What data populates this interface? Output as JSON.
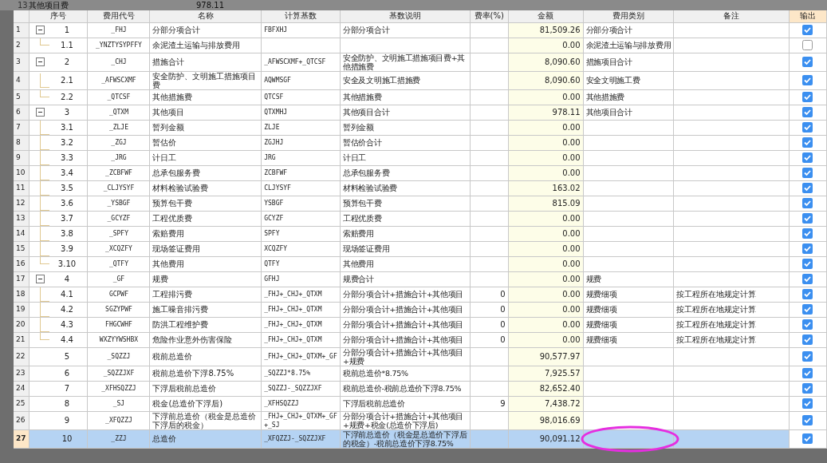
{
  "background_row": {
    "num": "13",
    "name": "其他项目费",
    "amount": "978.11"
  },
  "table": {
    "columns": [
      "序号",
      "费用代号",
      "名称",
      "计算基数",
      "基数说明",
      "费率(%)",
      "金额",
      "费用类别",
      "备注",
      "输出"
    ],
    "rows": [
      {
        "num": "1",
        "seq": "1",
        "code": "_FHJ",
        "name": "分部分项合计",
        "base": "FBFXHJ",
        "base_desc": "分部分项合计",
        "amount": "81,509.26",
        "category": "分部分项合计",
        "output": true,
        "selected": false,
        "expanded": true,
        "children": [
          {
            "num": "2",
            "seq": "1.1",
            "code": "_YNZTYSYPFFY",
            "name": "余泥渣土运输与排放费用",
            "amount": "0.00",
            "category": "余泥渣土运输与排放费用",
            "output": false,
            "selected": false
          }
        ]
      },
      {
        "num": "3",
        "seq": "2",
        "code": "_CHJ",
        "name": "措施合计",
        "base": "_AFWSCXMF+_QTCSF",
        "base_desc": "安全防护、文明施工措施项目费+其他措施费",
        "amount": "8,090.60",
        "category": "措施项目合计",
        "output": true,
        "selected": false,
        "expanded": true,
        "children": [
          {
            "num": "4",
            "seq": "2.1",
            "code": "_AFWSCXMF",
            "name": "安全防护、文明施工措施项目费",
            "base": "AQWMSGF",
            "base_desc": "安全及文明施工措施费",
            "amount": "8,090.60",
            "category": "安全文明施工费",
            "output": true,
            "selected": false
          },
          {
            "num": "5",
            "seq": "2.2",
            "code": "_QTCSF",
            "name": "其他措施费",
            "base": "QTCSF",
            "base_desc": "其他措施费",
            "amount": "0.00",
            "category": "其他措施费",
            "output": true,
            "selected": false
          }
        ]
      },
      {
        "num": "6",
        "seq": "3",
        "code": "_QTXM",
        "name": "其他项目",
        "base": "QTXMHJ",
        "base_desc": "其他项目合计",
        "amount": "978.11",
        "category": "其他项目合计",
        "output": true,
        "selected": false,
        "expanded": true,
        "children": [
          {
            "num": "7",
            "seq": "3.1",
            "code": "_ZLJE",
            "name": "暂列金额",
            "base": "ZLJE",
            "base_desc": "暂列金额",
            "amount": "0.00",
            "output": true,
            "selected": false
          },
          {
            "num": "8",
            "seq": "3.2",
            "code": "_ZGJ",
            "name": "暂估价",
            "base": "ZGJHJ",
            "base_desc": "暂估价合计",
            "amount": "0.00",
            "output": true,
            "selected": false
          },
          {
            "num": "9",
            "seq": "3.3",
            "code": "_JRG",
            "name": "计日工",
            "base": "JRG",
            "base_desc": "计日工",
            "amount": "0.00",
            "output": true,
            "selected": false
          },
          {
            "num": "10",
            "seq": "3.4",
            "code": "_ZCBFWF",
            "name": "总承包服务费",
            "base": "ZCBFWF",
            "base_desc": "总承包服务费",
            "amount": "0.00",
            "output": true,
            "selected": false
          },
          {
            "num": "11",
            "seq": "3.5",
            "code": "_CLJYSYF",
            "name": "材料检验试验费",
            "base": "CLJYSYF",
            "base_desc": "材料检验试验费",
            "amount": "163.02",
            "output": true,
            "selected": false
          },
          {
            "num": "12",
            "seq": "3.6",
            "code": "_YSBGF",
            "name": "预算包干费",
            "base": "YSBGF",
            "base_desc": "预算包干费",
            "amount": "815.09",
            "output": true,
            "selected": false
          },
          {
            "num": "13",
            "seq": "3.7",
            "code": "_GCYZF",
            "name": "工程优质费",
            "base": "GCYZF",
            "base_desc": "工程优质费",
            "amount": "0.00",
            "output": true,
            "selected": false
          },
          {
            "num": "14",
            "seq": "3.8",
            "code": "_SPFY",
            "name": "索赔费用",
            "base": "SPFY",
            "base_desc": "索赔费用",
            "amount": "0.00",
            "output": true,
            "selected": false
          },
          {
            "num": "15",
            "seq": "3.9",
            "code": "_XCQZFY",
            "name": "现场签证费用",
            "base": "XCQZFY",
            "base_desc": "现场签证费用",
            "amount": "0.00",
            "output": true,
            "selected": false
          },
          {
            "num": "16",
            "seq": "3.10",
            "code": "_QTFY",
            "name": "其他费用",
            "base": "QTFY",
            "base_desc": "其他费用",
            "amount": "0.00",
            "output": true,
            "selected": false
          }
        ]
      },
      {
        "num": "17",
        "seq": "4",
        "code": "_GF",
        "name": "规费",
        "base": "GFHJ",
        "base_desc": "规费合计",
        "amount": "0.00",
        "category": "规费",
        "output": true,
        "selected": false,
        "expanded": true,
        "children": [
          {
            "num": "18",
            "seq": "4.1",
            "code": "GCPWF",
            "name": "工程排污费",
            "base": "_FHJ+_CHJ+_QTXM",
            "base_desc": "分部分项合计+措施合计+其他项目",
            "rate": "0",
            "amount": "0.00",
            "category": "规费细项",
            "note": "按工程所在地规定计算",
            "output": true,
            "selected": false
          },
          {
            "num": "19",
            "seq": "4.2",
            "code": "SGZYPWF",
            "name": "施工噪音排污费",
            "base": "_FHJ+_CHJ+_QTXM",
            "base_desc": "分部分项合计+措施合计+其他项目",
            "rate": "0",
            "amount": "0.00",
            "category": "规费细项",
            "note": "按工程所在地规定计算",
            "output": true,
            "selected": false
          },
          {
            "num": "20",
            "seq": "4.3",
            "code": "FHGCWHF",
            "name": "防洪工程维护费",
            "base": "_FHJ+_CHJ+_QTXM",
            "base_desc": "分部分项合计+措施合计+其他项目",
            "rate": "0",
            "amount": "0.00",
            "category": "规费细项",
            "note": "按工程所在地规定计算",
            "output": true,
            "selected": false
          },
          {
            "num": "21",
            "seq": "4.4",
            "code": "WXZYYWSHBX",
            "name": "危险作业意外伤害保险",
            "base": "_FHJ+_CHJ+_QTXM",
            "base_desc": "分部分项合计+措施合计+其他项目",
            "rate": "0",
            "amount": "0.00",
            "category": "规费细项",
            "note": "按工程所在地规定计算",
            "output": true,
            "selected": false
          }
        ]
      },
      {
        "num": "22",
        "seq": "5",
        "code": "_SQZZJ",
        "name": "税前总造价",
        "base": "_FHJ+_CHJ+_QTXM+_GF",
        "base_desc": "分部分项合计+措施合计+其他项目+规费",
        "amount": "90,577.97",
        "output": true,
        "selected": false
      },
      {
        "num": "23",
        "seq": "6",
        "code": "_SQZZJXF",
        "name": "税前总造价下浮8.75%",
        "base": "_SQZZJ*8.75%",
        "base_desc": "税前总造价*8.75%",
        "amount": "7,925.57",
        "output": true,
        "selected": false
      },
      {
        "num": "24",
        "seq": "7",
        "code": "_XFHSQZZJ",
        "name": "下浮后税前总造价",
        "base": "_SQZZJ-_SQZZJXF",
        "base_desc": "税前总造价-税前总造价下浮8.75%",
        "amount": "82,652.40",
        "output": true,
        "selected": false
      },
      {
        "num": "25",
        "seq": "8",
        "code": "_SJ",
        "name": "税金(总造价下浮后)",
        "base": "_XFHSQZZJ",
        "base_desc": "下浮后税前总造价",
        "rate": "9",
        "amount": "7,438.72",
        "output": true,
        "selected": false
      },
      {
        "num": "26",
        "seq": "9",
        "code": "_XFQZZJ",
        "name": "下浮前总造价（税金是总造价下浮后的税金）",
        "base": "_FHJ+_CHJ+_QTXM+_GF+_SJ",
        "base_desc": "分部分项合计+措施合计+其他项目+规费+税金(总造价下浮后)",
        "amount": "98,016.69",
        "output": true,
        "selected": false
      },
      {
        "num": "27",
        "seq": "10",
        "code": "_ZZJ",
        "name": "总造价",
        "base": "_XFQZZJ-_SQZZJXF",
        "base_desc": "下浮前总造价（税金是总造价下浮后的税金）-税前总造价下浮8.75%",
        "amount": "90,091.12",
        "output": true,
        "selected": true
      }
    ]
  }
}
